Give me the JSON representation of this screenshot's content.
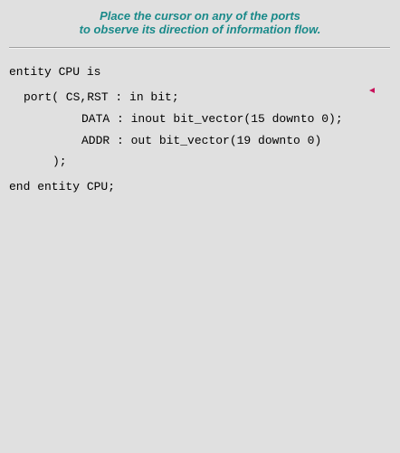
{
  "header": {
    "line1": "Place the cursor on any of the ports",
    "line2": "to observe its direction of information flow."
  },
  "code": {
    "entity_decl": "entity CPU is",
    "port_open": "port( CS,RST : in bit;",
    "data_port": "DATA : inout bit_vector(15 downto 0);",
    "addr_port": "ADDR : out bit_vector(19 downto 0)",
    "port_close": ");",
    "end_entity": "end entity CPU;"
  },
  "colors": {
    "header": "#1a8a8a",
    "background": "#e0e0e0",
    "marker": "#c8105a"
  }
}
